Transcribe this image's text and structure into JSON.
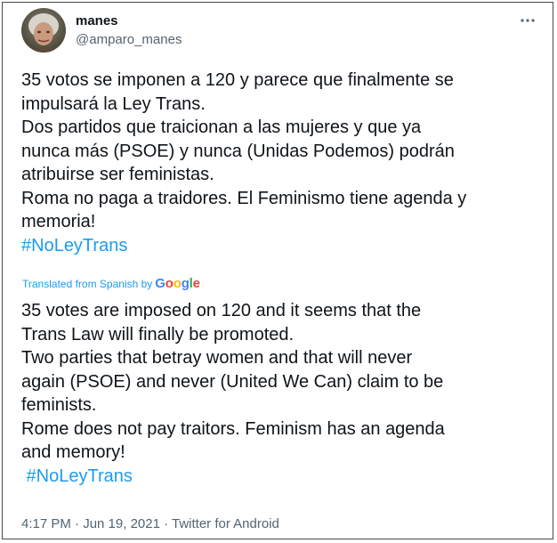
{
  "author": {
    "display_name": "manes",
    "handle": "@amparo_manes"
  },
  "original_text": {
    "lines": [
      "35 votos se imponen a 120 y parece que finalmente se",
      "impulsará la Ley Trans.",
      "Dos partidos que traicionan a las mujeres y que ya",
      "nunca más (PSOE) y nunca (Unidas Podemos) podrán",
      "atribuirse ser feministas.",
      "Roma no paga a traidores. El Feminismo tiene agenda y",
      "memoria!"
    ],
    "hashtag": "#NoLeyTrans"
  },
  "translation": {
    "label": "Translated from Spanish by",
    "provider": {
      "letters": [
        "G",
        "o",
        "o",
        "g",
        "l",
        "e"
      ]
    }
  },
  "translated_text": {
    "lines": [
      "35 votes are imposed on 120 and it seems that the",
      "Trans Law will finally be promoted.",
      " Two parties that betray women and that will never",
      "again (PSOE) and never (United We Can) claim to be",
      "feminists.",
      " Rome does not pay traitors. Feminism has an agenda",
      "and memory!"
    ],
    "hashtag": " #NoLeyTrans"
  },
  "meta": {
    "text": "4:17 PM · Jun 19, 2021 · Twitter for Android"
  },
  "icons": {
    "more": "more-options-icon",
    "avatar": "profile-photo"
  },
  "colors": {
    "link": "#1d9bf0",
    "text": "#0f1419",
    "secondary": "#536471",
    "border": "#4a4a4a"
  }
}
